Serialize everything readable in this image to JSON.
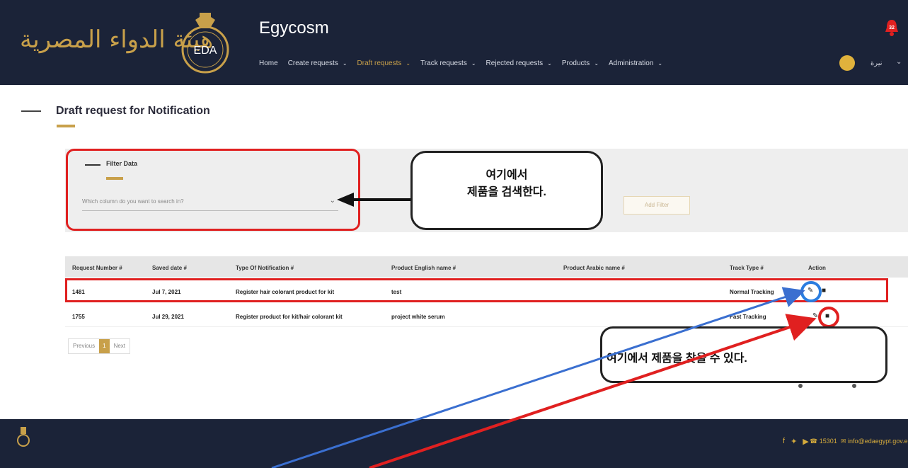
{
  "header": {
    "logo_text": "هيئة الدواء المصرية",
    "seal_text": "EDA",
    "app_title": "Egycosm",
    "nav": [
      {
        "label": "Home",
        "dropdown": false,
        "active": false
      },
      {
        "label": "Create requests",
        "dropdown": true,
        "active": false
      },
      {
        "label": "Draft requests",
        "dropdown": true,
        "active": true
      },
      {
        "label": "Track requests",
        "dropdown": true,
        "active": false
      },
      {
        "label": "Rejected requests",
        "dropdown": true,
        "active": false
      },
      {
        "label": "Products",
        "dropdown": true,
        "active": false
      },
      {
        "label": "Administration",
        "dropdown": true,
        "active": false
      }
    ],
    "notification_count": "32",
    "user_name": "نيرة"
  },
  "page": {
    "title": "Draft request for Notification"
  },
  "filter": {
    "label": "Filter Data",
    "select_placeholder": "Which column do you want to search in?",
    "add_filter_label": "Add Filter"
  },
  "callouts": {
    "search_line1": "여기에서",
    "search_line2": "제품을 검색한다.",
    "find": "여기에서 제품을 찾을 수 있다."
  },
  "table": {
    "columns": [
      "Request Number #",
      "Saved date #",
      "Type Of Notification #",
      "Product English name #",
      "Product Arabic name #",
      "Track Type #",
      "Action"
    ],
    "rows": [
      {
        "request_number": "1481",
        "saved_date": "Jul 7, 2021",
        "type": "Register hair colorant product for kit",
        "english_name": "test",
        "arabic_name": "",
        "track_type": "Normal Tracking"
      },
      {
        "request_number": "1755",
        "saved_date": "Jul 29, 2021",
        "type": "Register product for kit/hair colorant kit",
        "english_name": "project white serum",
        "arabic_name": "",
        "track_type": "Fast Tracking"
      }
    ]
  },
  "pagination": {
    "previous": "Previous",
    "current": "1",
    "next": "Next"
  },
  "footer": {
    "phone": "15301",
    "email": "info@edaegypt.gov.eg"
  },
  "colors": {
    "navy": "#1b2338",
    "gold": "#c8a04a",
    "highlight_red": "#e02020",
    "highlight_blue": "#2a7de0"
  }
}
